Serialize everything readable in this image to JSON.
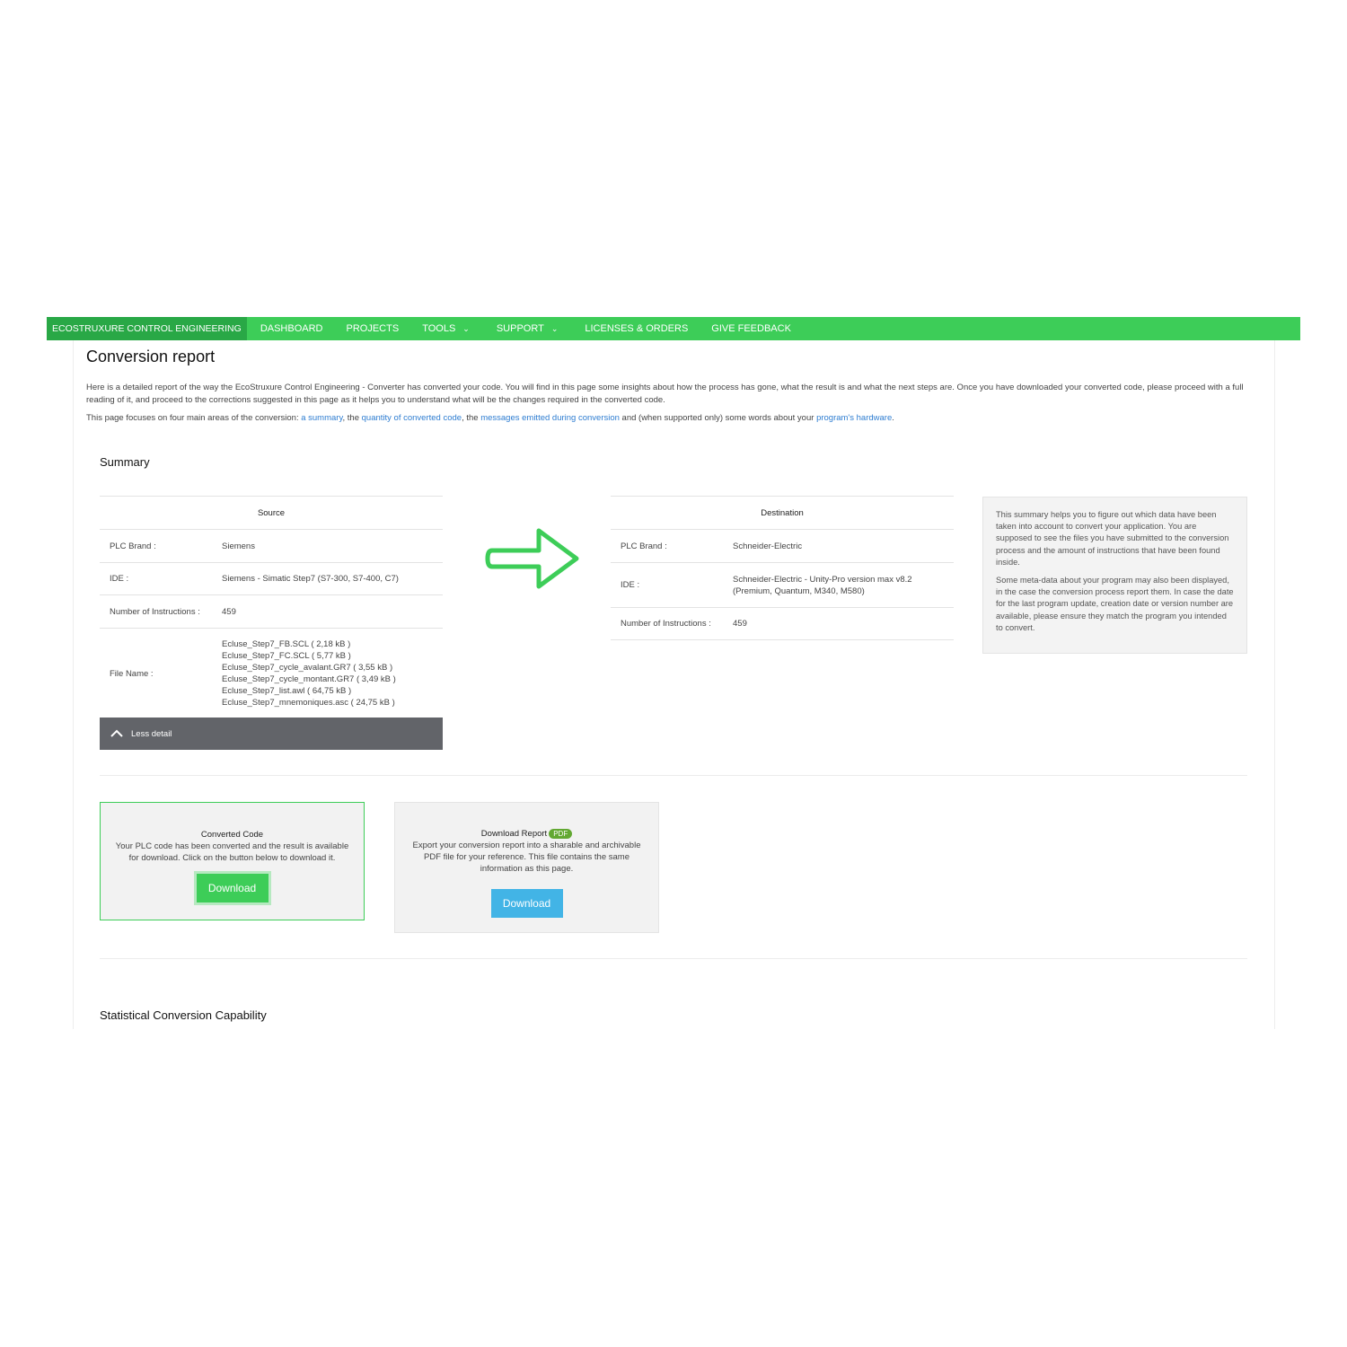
{
  "nav": {
    "brand": "ECOSTRUXURE CONTROL ENGINEERING",
    "items": [
      "DASHBOARD",
      "PROJECTS",
      "TOOLS",
      "SUPPORT",
      "LICENSES & ORDERS",
      "GIVE FEEDBACK"
    ],
    "chevron": "⌄"
  },
  "page": {
    "title": "Conversion report",
    "intro": "Here is a detailed report of the way the EcoStruxure Control Engineering - Converter has converted your code. You will find in this page some insights about how the process has gone, what the result is and what the next steps are. Once you have downloaded your converted code, please proceed with a full reading of it, and proceed to the corrections suggested in this page as it helps you to understand what will be the changes required in the converted code.",
    "focus": {
      "prefix": "This page focuses on four main areas of the conversion: ",
      "link1": "a summary",
      "sep1": ", the ",
      "link2": "quantity of converted code",
      "sep2": ", the ",
      "link3": "messages emitted during conversion",
      "sep3": " and (when supported only) some words about your ",
      "link4": "program's hardware",
      "suffix": "."
    }
  },
  "summary": {
    "title": "Summary",
    "source": {
      "header": "Source",
      "plc_brand_label": "PLC Brand :",
      "plc_brand": "Siemens",
      "ide_label": "IDE :",
      "ide": "Siemens - Simatic Step7 (S7-300, S7-400, C7)",
      "instr_label": "Number of Instructions :",
      "instr": "459",
      "file_label": "File Name :",
      "files": [
        "Ecluse_Step7_FB.SCL ( 2,18 kB )",
        "Ecluse_Step7_FC.SCL ( 5,77 kB )",
        "Ecluse_Step7_cycle_avalant.GR7 ( 3,55 kB )",
        "Ecluse_Step7_cycle_montant.GR7 ( 3,49 kB )",
        "Ecluse_Step7_list.awl ( 64,75 kB )",
        "Ecluse_Step7_mnemoniques.asc ( 24,75 kB )"
      ],
      "less_detail": "Less detail"
    },
    "destination": {
      "header": "Destination",
      "plc_brand_label": "PLC Brand :",
      "plc_brand": "Schneider-Electric",
      "ide_label": "IDE :",
      "ide_line1": "Schneider-Electric - Unity-Pro version max v8.2",
      "ide_line2": "(Premium, Quantum, M340, M580)",
      "instr_label": "Number of Instructions :",
      "instr": "459"
    },
    "info": {
      "p1": "This summary helps you to figure out which data have been taken into account to convert your application. You are supposed to see the files you have submitted to the conversion process and the amount of instructions that have been found inside.",
      "p2": "Some meta-data about your program may also been displayed, in the case the conversion process report them. In case the date for the last program update, creation date or version number are available, please ensure they match the program you intended to convert."
    }
  },
  "converted": {
    "title": "Converted Code",
    "text": "Your PLC code has been converted and the result is available for download. Click on the button below to download it.",
    "button": "Download"
  },
  "report": {
    "title": "Download Report",
    "badge": "PDF",
    "text": "Export your conversion report into a sharable and archivable PDF file for your reference. This file contains the same information as this page.",
    "button": "Download"
  },
  "stats": {
    "title": "Statistical Conversion Capability"
  },
  "colors": {
    "nav": "#3dcd58",
    "nav_brand": "#29a846",
    "link": "#2e7dd1",
    "green_button": "#3dcd58",
    "blue_button": "#42b4e6",
    "arrow": "#3dcd58"
  },
  "icons": {
    "arrow": "right-arrow-icon",
    "caret": "chevron-up-icon"
  }
}
